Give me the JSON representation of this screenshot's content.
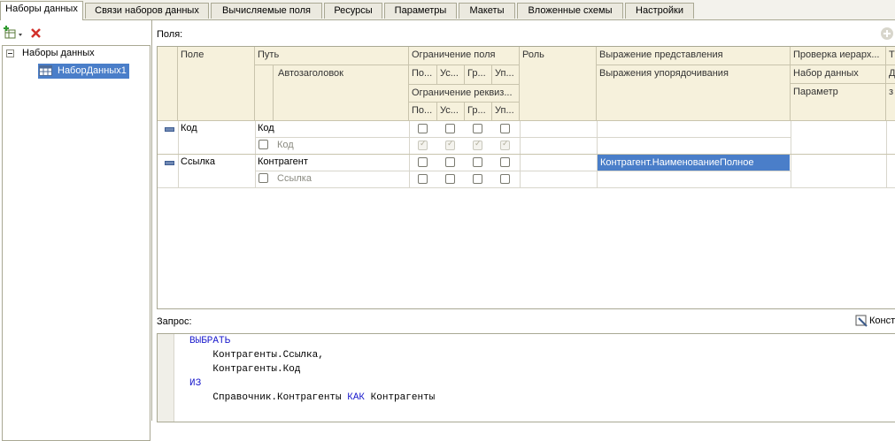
{
  "tabs": [
    {
      "label": "Наборы данных"
    },
    {
      "label": "Связи наборов данных"
    },
    {
      "label": "Вычисляемые поля"
    },
    {
      "label": "Ресурсы"
    },
    {
      "label": "Параметры"
    },
    {
      "label": "Макеты"
    },
    {
      "label": "Вложенные схемы"
    },
    {
      "label": "Настройки"
    }
  ],
  "tree": {
    "root": "Наборы данных",
    "child": "НаборДанных1"
  },
  "fields_label": "Поля:",
  "grid": {
    "headers": {
      "field": "Поле",
      "path": "Путь",
      "autotitle": "Автозаголовок",
      "field_restriction": "Ограничение поля",
      "restr_1": "По...",
      "restr_2": "Ус...",
      "restr_3": "Гр...",
      "restr_4": "Уп...",
      "attr_restriction": "Ограничение реквиз...",
      "attr_1": "По...",
      "attr_2": "Ус...",
      "attr_3": "Гр...",
      "attr_4": "Уп...",
      "role": "Роль",
      "presentation_expr": "Выражение представления",
      "ordering_expr": "Выражения упорядочивания",
      "hierarchy_check": "Проверка иерарх...",
      "dataset": "Набор данных",
      "parameter": "Параметр",
      "col_t": "Т",
      "col_d": "Д",
      "col_z": "з"
    },
    "rows": [
      {
        "field": "Код",
        "path": "Код",
        "autotitle": "Код",
        "presentation": ""
      },
      {
        "field": "Ссылка",
        "path": "Контрагент",
        "autotitle": "Ссылка",
        "presentation": "Контрагент.НаименованиеПолное"
      }
    ]
  },
  "query_label": "Запрос:",
  "constructor_label": "Конст",
  "query": {
    "line1_kw": "ВЫБРАТЬ",
    "line2": "    Контрагенты.Ссылка,",
    "line3": "    Контрагенты.Код",
    "line4_kw": "ИЗ",
    "line5_a": "    Справочник.Контрагенты ",
    "line5_kw": "КАК",
    "line5_b": " Контрагенты"
  },
  "colors": {
    "accent_selection": "#4a7ec9",
    "keyword": "#1a1acc",
    "header_bg": "#f6f1dc"
  }
}
